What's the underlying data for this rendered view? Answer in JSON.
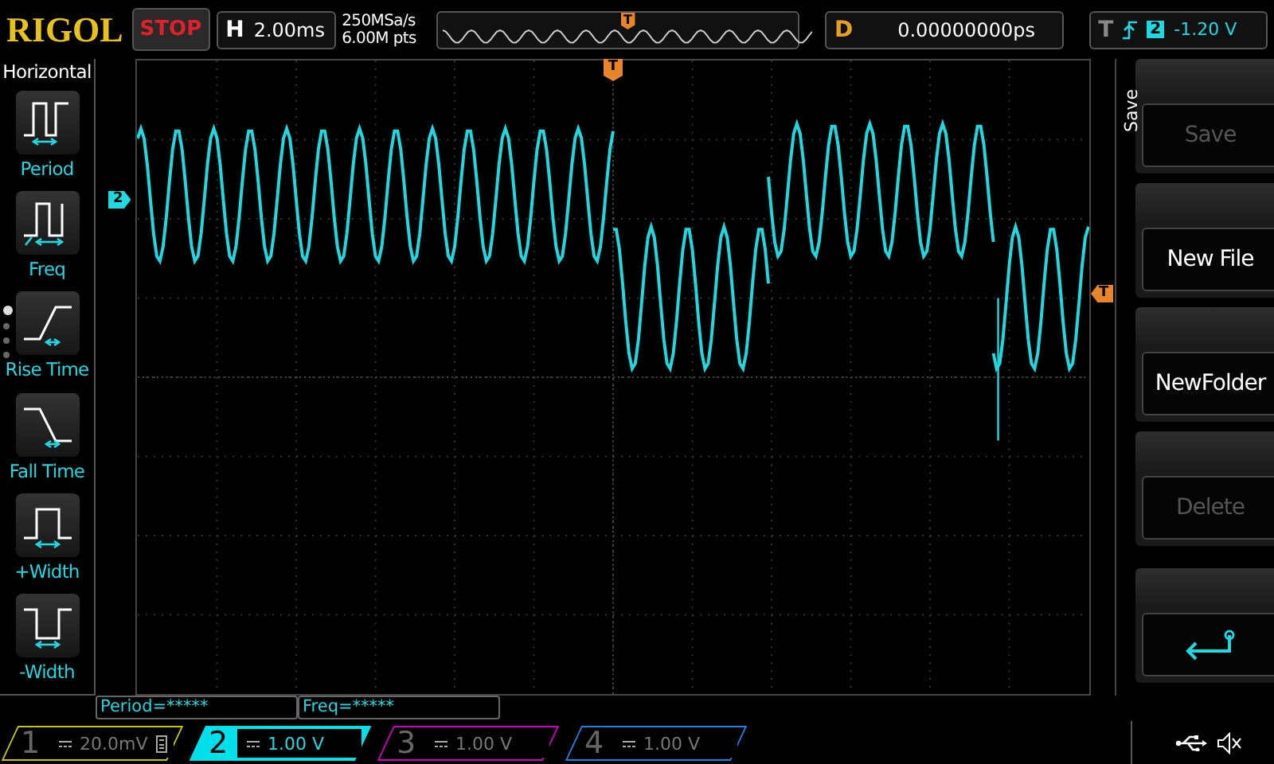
{
  "brand": "RIGOL",
  "run_state": "STOP",
  "timebase": {
    "label": "H",
    "value": "2.00ms"
  },
  "sample_rate": "250MSa/s",
  "memory_depth": "6.00M pts",
  "overview": {
    "trigger_marker": "T"
  },
  "delay": {
    "label": "D",
    "value": "0.00000000ps"
  },
  "trigger": {
    "label": "T",
    "source": "2",
    "level": "-1.20 V"
  },
  "left_menu": {
    "title": "Horizontal",
    "items": [
      {
        "kind": "period",
        "label": "Period"
      },
      {
        "kind": "freq",
        "label": "Freq"
      },
      {
        "kind": "rise",
        "label": "Rise Time"
      },
      {
        "kind": "fall",
        "label": "Fall Time"
      },
      {
        "kind": "pwidth",
        "label": "+Width"
      },
      {
        "kind": "nwidth",
        "label": "-Width"
      }
    ],
    "pages": [
      {
        "selected": true
      },
      {
        "selected": false
      },
      {
        "selected": false
      },
      {
        "selected": false
      }
    ]
  },
  "waveform": {
    "channel_marker": "2",
    "trigger_marker": "T",
    "level_marker": "T"
  },
  "right_menu": {
    "title": "Save",
    "buttons": [
      {
        "kind": "text",
        "label": "Save",
        "disabled": true
      },
      {
        "kind": "text",
        "label": "New File",
        "disabled": false
      },
      {
        "kind": "text",
        "label": "NewFolder",
        "disabled": false
      },
      {
        "kind": "text",
        "label": "Delete",
        "disabled": true
      },
      {
        "kind": "spacer"
      },
      {
        "kind": "return"
      }
    ]
  },
  "measurements": [
    "Period=*****",
    "Freq=*****"
  ],
  "channels": [
    {
      "number": "1",
      "scale": "20.0mV",
      "selected": false,
      "bw_limit": true,
      "color": "#c8c800"
    },
    {
      "number": "2",
      "scale": "1.00 V",
      "selected": true,
      "bw_limit": false,
      "color": "#00e0e8"
    },
    {
      "number": "3",
      "scale": "1.00 V",
      "selected": false,
      "bw_limit": false,
      "color": "#d000c0"
    },
    {
      "number": "4",
      "scale": "1.00 V",
      "selected": false,
      "bw_limit": false,
      "color": "#2080e0"
    }
  ]
}
